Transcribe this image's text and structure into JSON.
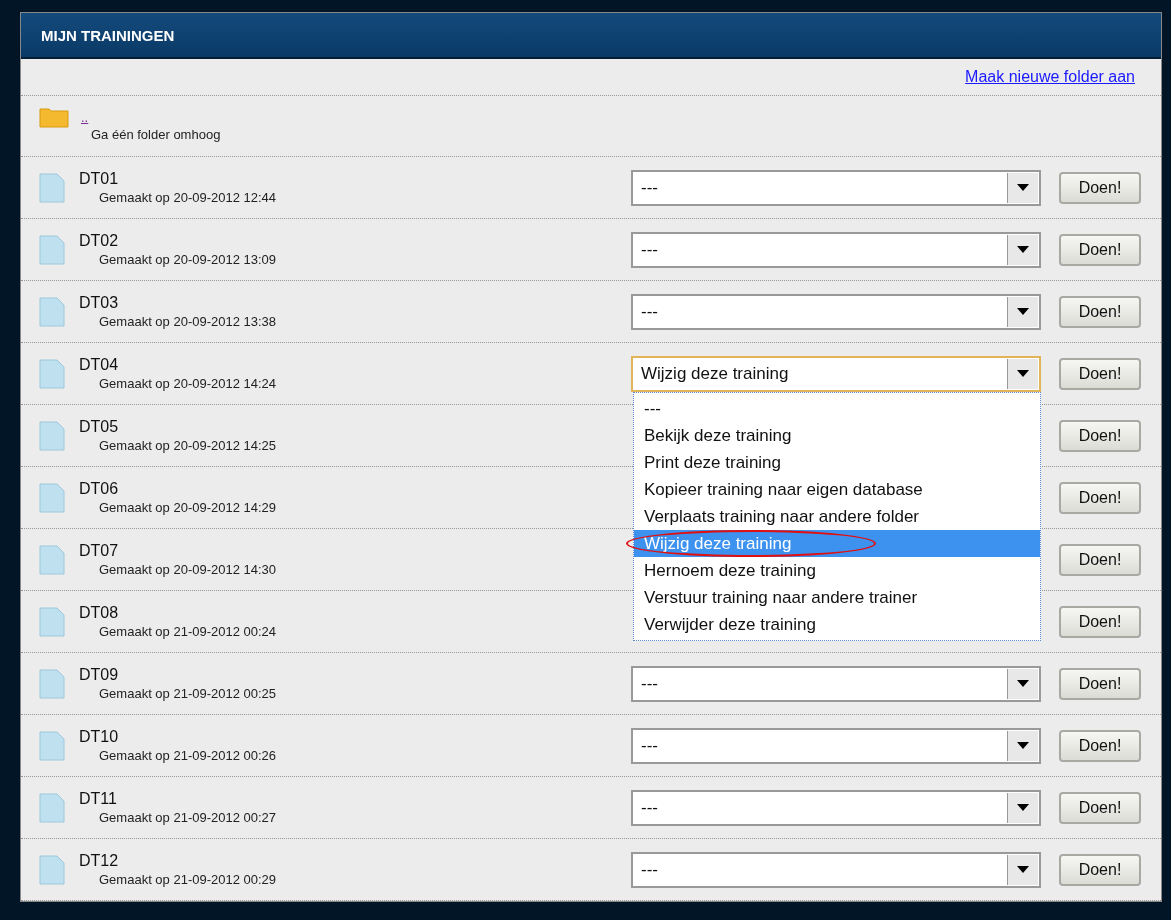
{
  "panel": {
    "title": "MIJN TRAININGEN"
  },
  "new_folder_link": "Maak nieuwe folder aan",
  "up_folder": {
    "link": "..",
    "label": "Ga één folder omhoog"
  },
  "rows": [
    {
      "name": "DT01",
      "created": "Gemaakt op 20-09-2012 12:44",
      "button": "Doen!",
      "select": {
        "value": "---",
        "open": false
      }
    },
    {
      "name": "DT02",
      "created": "Gemaakt op 20-09-2012 13:09",
      "button": "Doen!",
      "select": {
        "value": "---",
        "open": false
      }
    },
    {
      "name": "DT03",
      "created": "Gemaakt op 20-09-2012 13:38",
      "button": "Doen!",
      "select": {
        "value": "---",
        "open": false
      }
    },
    {
      "name": "DT04",
      "created": "Gemaakt op 20-09-2012 14:24",
      "button": "Doen!",
      "select": {
        "value": "Wijzig deze training",
        "open": true
      }
    },
    {
      "name": "DT05",
      "created": "Gemaakt op 20-09-2012 14:25",
      "button": "Doen!"
    },
    {
      "name": "DT06",
      "created": "Gemaakt op 20-09-2012 14:29",
      "button": "Doen!"
    },
    {
      "name": "DT07",
      "created": "Gemaakt op 20-09-2012 14:30",
      "button": "Doen!"
    },
    {
      "name": "DT08",
      "created": "Gemaakt op 21-09-2012 00:24",
      "button": "Doen!"
    },
    {
      "name": "DT09",
      "created": "Gemaakt op 21-09-2012 00:25",
      "button": "Doen!",
      "select": {
        "value": "---",
        "open": false
      }
    },
    {
      "name": "DT10",
      "created": "Gemaakt op 21-09-2012 00:26",
      "button": "Doen!",
      "select": {
        "value": "---",
        "open": false
      }
    },
    {
      "name": "DT11",
      "created": "Gemaakt op 21-09-2012 00:27",
      "button": "Doen!",
      "select": {
        "value": "---",
        "open": false
      }
    },
    {
      "name": "DT12",
      "created": "Gemaakt op 21-09-2012 00:29",
      "button": "Doen!",
      "select": {
        "value": "---",
        "open": false
      }
    }
  ],
  "dropdown_options": [
    {
      "label": "---",
      "selected": false,
      "circled": false
    },
    {
      "label": "Bekijk deze training",
      "selected": false,
      "circled": false
    },
    {
      "label": "Print deze training",
      "selected": false,
      "circled": false
    },
    {
      "label": "Kopieer training naar eigen database",
      "selected": false,
      "circled": false
    },
    {
      "label": "Verplaats training naar andere folder",
      "selected": false,
      "circled": false
    },
    {
      "label": "Wijzig deze training",
      "selected": true,
      "circled": true
    },
    {
      "label": "Hernoem deze training",
      "selected": false,
      "circled": false
    },
    {
      "label": "Verstuur training naar andere trainer",
      "selected": false,
      "circled": false
    },
    {
      "label": "Verwijder deze training",
      "selected": false,
      "circled": false
    }
  ]
}
